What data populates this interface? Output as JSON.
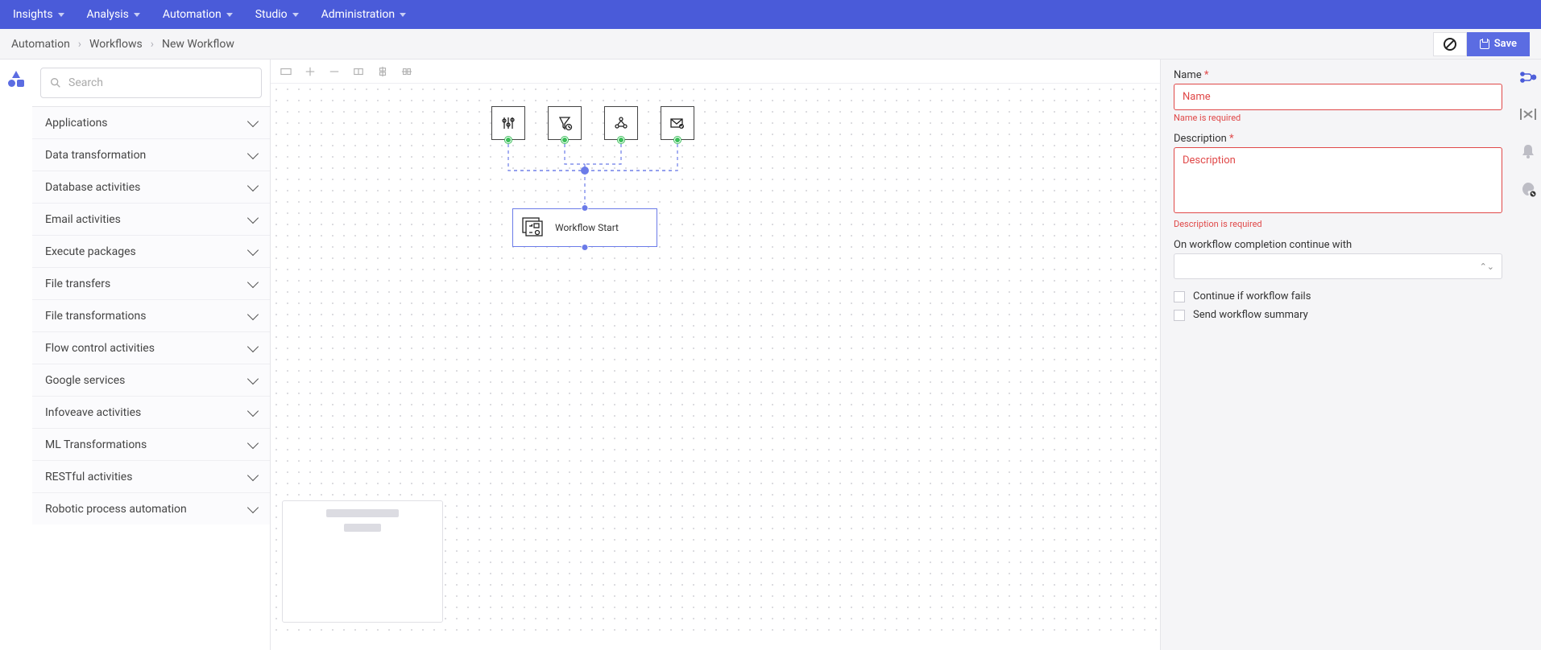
{
  "topnav": [
    "Insights",
    "Analysis",
    "Automation",
    "Studio",
    "Administration"
  ],
  "breadcrumb": [
    "Automation",
    "Workflows",
    "New Workflow"
  ],
  "save_label": "Save",
  "search_placeholder": "Search",
  "categories": [
    "Applications",
    "Data transformation",
    "Database activities",
    "Email activities",
    "Execute packages",
    "File transfers",
    "File transformations",
    "Flow control activities",
    "Google services",
    "Infoveave activities",
    "ML Transformations",
    "RESTful activities",
    "Robotic process automation"
  ],
  "start_node_label": "Workflow Start",
  "props": {
    "name_label": "Name",
    "name_placeholder": "Name",
    "name_error": "Name is required",
    "desc_label": "Description",
    "desc_placeholder": "Description",
    "desc_error": "Description is required",
    "continue_label": "On workflow completion continue with",
    "cb_fail": "Continue if workflow fails",
    "cb_summary": "Send workflow summary"
  }
}
